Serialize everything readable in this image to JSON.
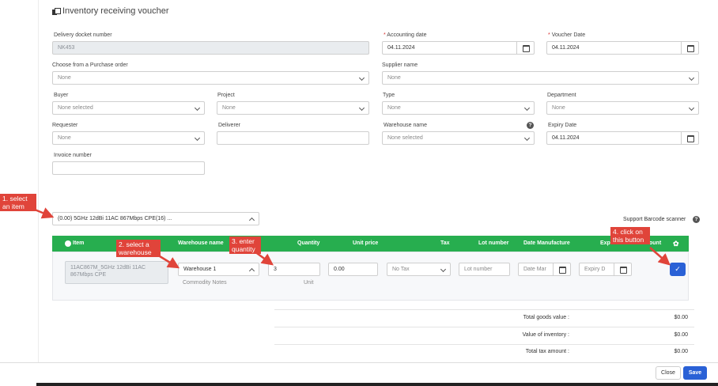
{
  "header": {
    "title": "Inventory receiving voucher"
  },
  "form": {
    "delivery_docket": {
      "label": "Delivery docket number",
      "value": "NK453"
    },
    "accounting_date": {
      "required": "*",
      "label": "Accounting date",
      "value": "04.11.2024"
    },
    "voucher_date": {
      "required": "*",
      "label": "Voucher Date",
      "value": "04.11.2024"
    },
    "purchase_order": {
      "label": "Choose from a Purchase order",
      "value": "None"
    },
    "supplier": {
      "label": "Supplier name",
      "value": "None"
    },
    "buyer": {
      "label": "Buyer",
      "value": "None selected"
    },
    "project": {
      "label": "Project",
      "value": "None"
    },
    "type": {
      "label": "Type",
      "value": "None"
    },
    "department": {
      "label": "Department",
      "value": "None"
    },
    "requester": {
      "label": "Requester",
      "value": "None"
    },
    "deliverer": {
      "label": "Deliverer",
      "value": ""
    },
    "warehouse": {
      "label": "Warehouse name",
      "value": "None selected",
      "help": "?"
    },
    "expiry_date": {
      "label": "Expiry Date",
      "value": "04.11.2024"
    },
    "invoice": {
      "label": "Invoice number",
      "value": ""
    }
  },
  "item_select": {
    "value": "(0.00) 5GHz 12dBi 11AC 867Mbps CPE(16) ..."
  },
  "barcode": {
    "label": "Support Barcode scanner",
    "help": "?"
  },
  "table": {
    "headers": {
      "item": "Item",
      "warehouse": "Warehouse name",
      "quantity": "Quantity",
      "unit_price": "Unit price",
      "tax": "Tax",
      "lot": "Lot number",
      "date_manufacture": "Date Manufacture",
      "expiry_hidden": "Expi",
      "amount_hidden": "ount"
    },
    "row": {
      "item_text": "11AC867M_5GHz 12dBi 11AC 867Mbps CPE",
      "warehouse": "Warehouse 1",
      "commodity_notes": "Commodity Notes",
      "quantity": "3",
      "unit": "Unit",
      "unit_price": "0.00",
      "tax": "No Tax",
      "lot_placeholder": "Lot number",
      "date_placeholder": "Date Mar",
      "expiry_placeholder": "Expiry D"
    }
  },
  "summary": {
    "goods_label": "Total goods value :",
    "goods_value": "$0.00",
    "inventory_label": "Value of inventory :",
    "inventory_value": "$0.00",
    "tax_label": "Total tax amount :",
    "tax_value": "$0.00"
  },
  "footer": {
    "close": "Close",
    "save": "Save"
  },
  "callouts": {
    "c1": "1. select an item",
    "c2": "2. select a warehouse",
    "c3": "3. enter quantity",
    "c4": "4. click on this button"
  },
  "colors": {
    "header_green": "#27ae4f",
    "callout_red": "#e0443a",
    "primary_blue": "#2a61d6"
  }
}
